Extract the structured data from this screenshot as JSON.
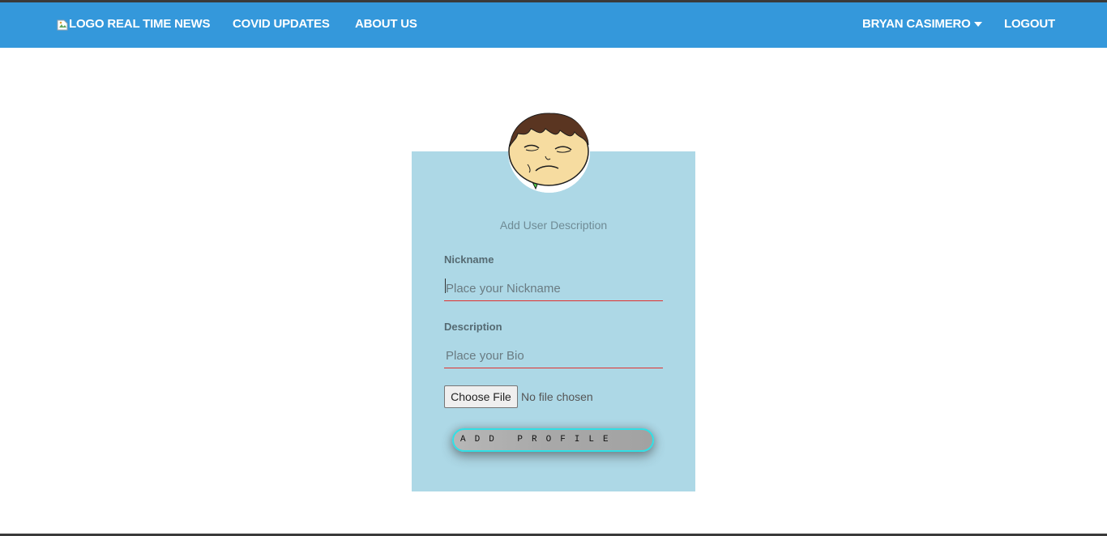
{
  "navbar": {
    "brand_alt": "LOGO",
    "brand_text": "REAL TIME NEWS",
    "items": [
      {
        "label": "COVID UPDATES"
      },
      {
        "label": "ABOUT US"
      }
    ],
    "user_label": "BRYAN CASIMERO",
    "logout_label": "LOGOUT",
    "bg_color": "#3498db"
  },
  "card": {
    "title": "Add User Description",
    "bg_color": "#add8e6",
    "nickname": {
      "label": "Nickname",
      "placeholder": "Place your Nickname",
      "value": ""
    },
    "description": {
      "label": "Description",
      "placeholder": "Place your Bio",
      "value": ""
    },
    "file": {
      "button_label": "Choose File",
      "status": "No file chosen"
    },
    "submit_label": "ADD  PROFILE"
  }
}
